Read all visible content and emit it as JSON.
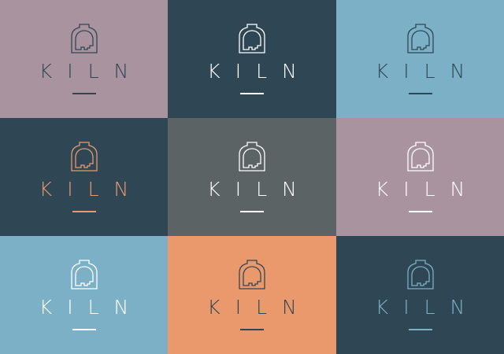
{
  "brand_name": "KILN",
  "icon": "kiln-furnace-icon",
  "palette": {
    "mauve": "#a9939f",
    "navy": "#2f4755",
    "sky": "#7cb0c6",
    "slate": "#5b6364",
    "orange": "#e9996c"
  },
  "tiles": [
    {
      "id": "tile-1",
      "background": "#a9939f",
      "foreground": "#2f4755",
      "label": "KILN"
    },
    {
      "id": "tile-2",
      "background": "#2f4755",
      "foreground": "#ffffff",
      "label": "KILN"
    },
    {
      "id": "tile-3",
      "background": "#7cb0c6",
      "foreground": "#2f4755",
      "label": "KILN"
    },
    {
      "id": "tile-4",
      "background": "#2f4755",
      "foreground": "#e9996c",
      "label": "KILN"
    },
    {
      "id": "tile-5",
      "background": "#5b6364",
      "foreground": "#ffffff",
      "label": "KILN"
    },
    {
      "id": "tile-6",
      "background": "#a9939f",
      "foreground": "#ffffff",
      "label": "KILN"
    },
    {
      "id": "tile-7",
      "background": "#7cb0c6",
      "foreground": "#ffffff",
      "label": "KILN"
    },
    {
      "id": "tile-8",
      "background": "#e9996c",
      "foreground": "#2f4755",
      "label": "KILN"
    },
    {
      "id": "tile-9",
      "background": "#2f4755",
      "foreground": "#7cb0c6",
      "label": "KILN"
    }
  ]
}
